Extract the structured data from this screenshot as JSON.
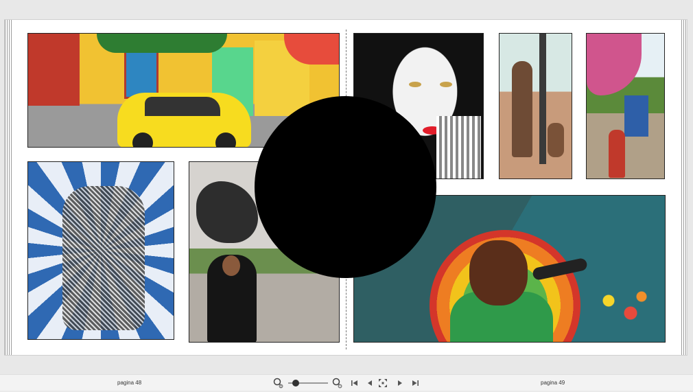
{
  "viewer": {
    "left_page_label": "pagina 48",
    "right_page_label": "pagina 49",
    "zoom_level_fraction": 0.12
  },
  "icons": {
    "zoom_out": "zoom-out-icon",
    "zoom_in": "zoom-in-icon",
    "first_page": "first-page-icon",
    "prev_page": "previous-page-icon",
    "fit_page": "fit-page-icon",
    "next_page": "next-page-icon",
    "last_page": "last-page-icon"
  },
  "colors": {
    "toolbar_bg": "#f3f3f3",
    "redaction_disc": "#000000",
    "page_bg": "#ffffff"
  }
}
